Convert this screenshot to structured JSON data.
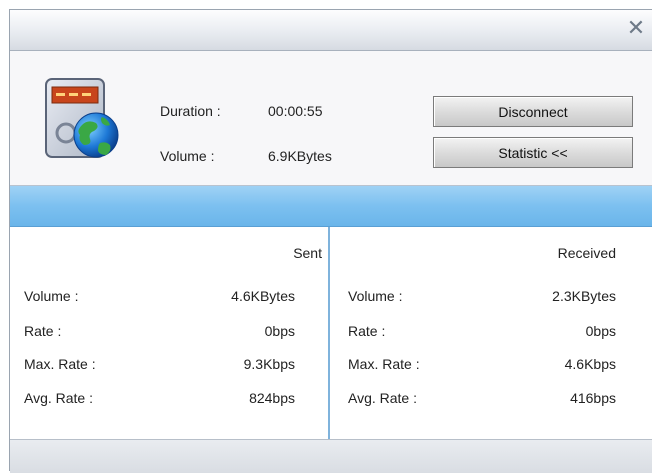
{
  "window": {
    "close_symbol": "✕"
  },
  "connection": {
    "duration_label": "Duration :",
    "duration_value": "00:00:55",
    "volume_label": "Volume :",
    "volume_value": "6.9KBytes"
  },
  "buttons": {
    "disconnect": "Disconnect",
    "statistic": "Statistic   <<"
  },
  "stats": {
    "sent": {
      "header": "Sent",
      "rows": [
        {
          "label": "Volume :",
          "value": "4.6KBytes"
        },
        {
          "label": "Rate :",
          "value": "0bps"
        },
        {
          "label": "Max. Rate :",
          "value": "9.3Kbps"
        },
        {
          "label": "Avg. Rate :",
          "value": "824bps"
        }
      ]
    },
    "received": {
      "header": "Received",
      "rows": [
        {
          "label": "Volume :",
          "value": "2.3KBytes"
        },
        {
          "label": "Rate :",
          "value": "0bps"
        },
        {
          "label": "Max. Rate :",
          "value": "4.6Kbps"
        },
        {
          "label": "Avg. Rate :",
          "value": "416bps"
        }
      ]
    }
  },
  "icons": {
    "app": "modem-globe-icon",
    "close": "close-icon"
  },
  "colors": {
    "band": "#7cc0f0",
    "separator": "#7fb3dc",
    "title_gradient_bottom": "#d6dbe2"
  }
}
